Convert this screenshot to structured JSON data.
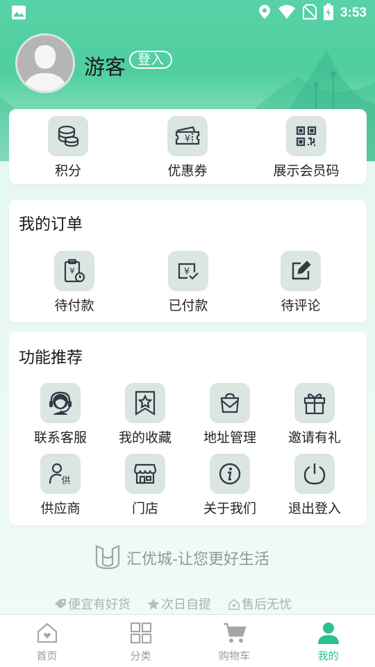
{
  "status_bar": {
    "time": "3:53"
  },
  "profile": {
    "name": "游客",
    "login_label": "登入"
  },
  "quick_actions": [
    {
      "label": "积分",
      "icon": "coins-icon"
    },
    {
      "label": "优惠券",
      "icon": "coupon-icon"
    },
    {
      "label": "展示会员码",
      "icon": "qrcode-icon"
    }
  ],
  "orders": {
    "title": "我的订单",
    "items": [
      {
        "label": "待付款",
        "icon": "clipboard-clock-icon"
      },
      {
        "label": "已付款",
        "icon": "yen-check-icon"
      },
      {
        "label": "待评论",
        "icon": "edit-icon"
      }
    ]
  },
  "features": {
    "title": "功能推荐",
    "items": [
      {
        "label": "联系客服",
        "icon": "headset-icon"
      },
      {
        "label": "我的收藏",
        "icon": "bookmark-star-icon"
      },
      {
        "label": "地址管理",
        "icon": "address-bag-icon"
      },
      {
        "label": "邀请有礼",
        "icon": "gift-icon"
      },
      {
        "label": "供应商",
        "icon": "supplier-icon"
      },
      {
        "label": "门店",
        "icon": "store-icon"
      },
      {
        "label": "关于我们",
        "icon": "info-icon"
      },
      {
        "label": "退出登入",
        "icon": "power-icon"
      }
    ]
  },
  "slogan": "汇优城-让您更好生活",
  "promises": [
    "便宜有好货",
    "次日自提",
    "售后无忧"
  ],
  "bottom_nav": [
    {
      "label": "首页",
      "icon": "home-icon",
      "active": false
    },
    {
      "label": "分类",
      "icon": "category-icon",
      "active": false
    },
    {
      "label": "购物车",
      "icon": "cart-icon",
      "active": false
    },
    {
      "label": "我的",
      "icon": "user-icon",
      "active": true
    }
  ],
  "colors": {
    "accent": "#2ac28f",
    "hero": "#4fcea0",
    "icon_bg": "#dbe5e1"
  }
}
